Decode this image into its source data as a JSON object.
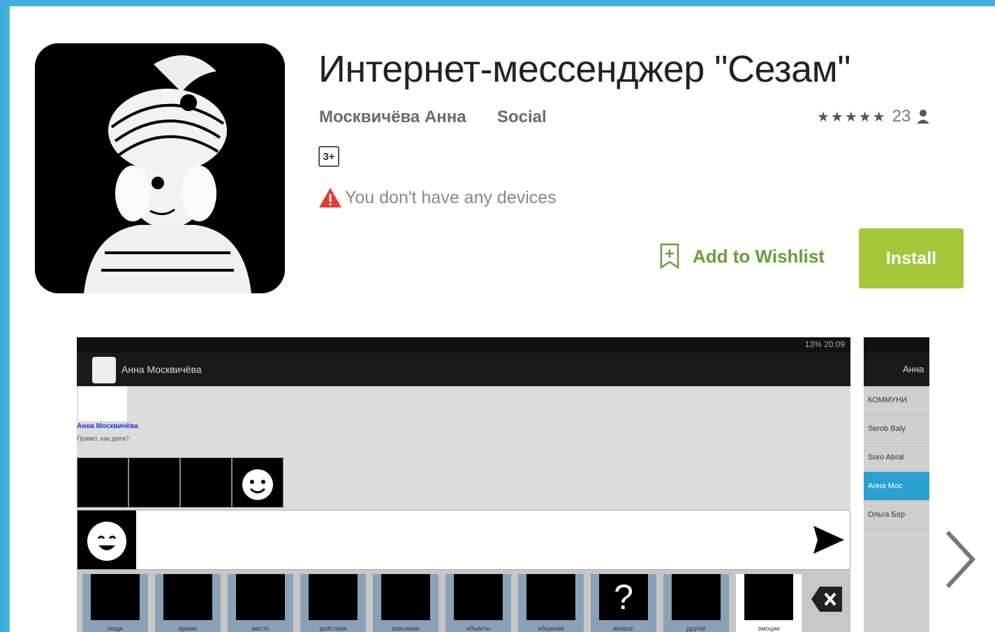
{
  "app": {
    "title": "Интернет-мессенджер \"Сезам\"",
    "author": "Москвичёва Анна",
    "category": "Social",
    "rating_count": "23",
    "content_rating": "3+",
    "warning_text": "You don't have any devices",
    "wishlist_label": "Add to Wishlist",
    "install_label": "Install"
  },
  "colors": {
    "accent_green": "#a4c639",
    "wishlist_green": "#689f38",
    "border_blue": "#3fb0de",
    "warning_red": "#e53935"
  },
  "icons": [
    "star-icon",
    "person-icon",
    "warning-icon",
    "bookmark-plus-icon",
    "chevron-right-icon",
    "send-icon",
    "backspace-icon"
  ],
  "screenshot": {
    "status_time": "13%  20:09",
    "contact_name": "Анна Москвичёва",
    "message_sender": "Анна Москвичёва",
    "message_text": "Привет, как дела?",
    "tray_labels": [
      "люди",
      "время",
      "место",
      "действия",
      "описание",
      "объекты",
      "общение",
      "вопрос",
      "другое",
      "эмоции"
    ]
  },
  "screenshot2": {
    "header_name": "Анна",
    "contacts": [
      "КОММУНИ",
      "Serob Baly",
      "Suro Abral",
      "Анна Мос",
      "Ольга Бор"
    ]
  }
}
